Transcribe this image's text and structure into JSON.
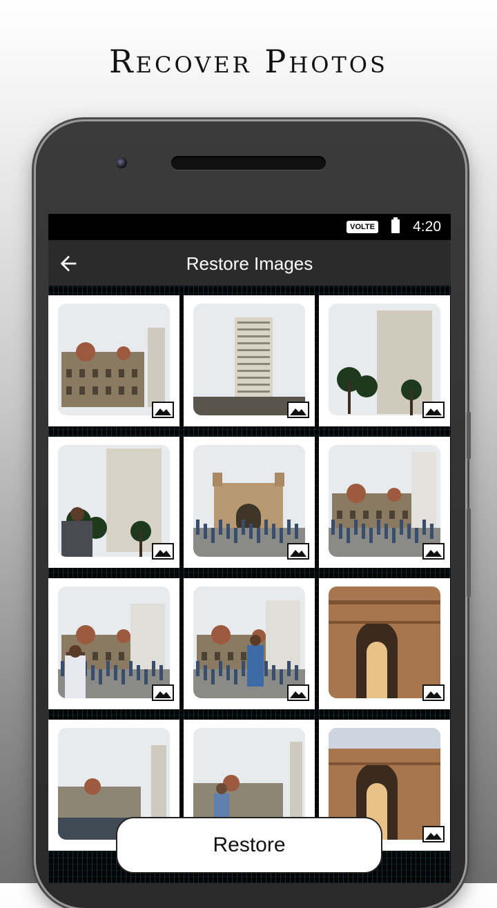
{
  "promo": {
    "title": "Recover Photos"
  },
  "status_bar": {
    "network_badge": "VOLTE",
    "time": "4:20"
  },
  "app_bar": {
    "title": "Restore Images",
    "back_icon": "arrow-left-icon"
  },
  "gallery": {
    "item_icon": "image-icon",
    "items": [
      {
        "scene": "heritage-hotel-tower"
      },
      {
        "scene": "tall-tower-sky"
      },
      {
        "scene": "tower-palms"
      },
      {
        "scene": "tower-palms-person"
      },
      {
        "scene": "gateway-crowd"
      },
      {
        "scene": "hotel-crowd"
      },
      {
        "scene": "hotel-person-selfie"
      },
      {
        "scene": "hotel-person-standing"
      },
      {
        "scene": "gateway-arch-closeup"
      },
      {
        "scene": "hotel-waterfront"
      },
      {
        "scene": "hotel-waterfront-people"
      },
      {
        "scene": "gateway-arch-side"
      }
    ]
  },
  "footer": {
    "restore_label": "Restore"
  }
}
